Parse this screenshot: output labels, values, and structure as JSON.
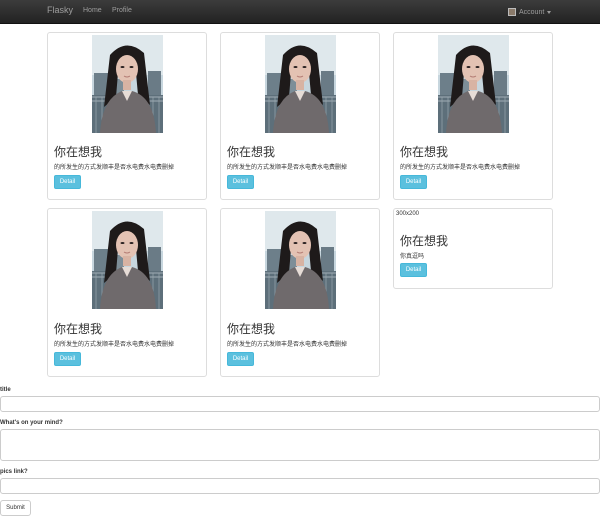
{
  "navbar": {
    "brand": "Flasky",
    "links": [
      "Home",
      "Profile"
    ],
    "account_label": "Account"
  },
  "cards": [
    {
      "title": "你在想我",
      "text": "的所发生的方式发顺丰是否水电费水电费删掉",
      "button": "Detail",
      "image": "portrait-photo"
    },
    {
      "title": "你在想我",
      "text": "的所发生的方式发顺丰是否水电费水电费删掉",
      "button": "Detail",
      "image": "portrait-photo"
    },
    {
      "title": "你在想我",
      "text": "的所发生的方式发顺丰是否水电费水电费删掉",
      "button": "Detail",
      "image": "portrait-photo"
    },
    {
      "title": "你在想我",
      "text": "的所发生的方式发顺丰是否水电费水电费删掉",
      "button": "Detail",
      "image": "portrait-photo"
    },
    {
      "title": "你在想我",
      "text": "的所发生的方式发顺丰是否水电费水电费删掉",
      "button": "Detail",
      "image": "portrait-photo"
    },
    {
      "placeholder": "300x200",
      "title": "你在想我",
      "text": "你真逗吗",
      "button": "Detail"
    }
  ],
  "form": {
    "title_label": "title",
    "mind_label": "What's on your mind?",
    "pics_label": "pics link?",
    "submit_label": "Submit"
  },
  "colors": {
    "navbar": "#222222",
    "info_button": "#5bc0de",
    "border": "#dddddd"
  }
}
